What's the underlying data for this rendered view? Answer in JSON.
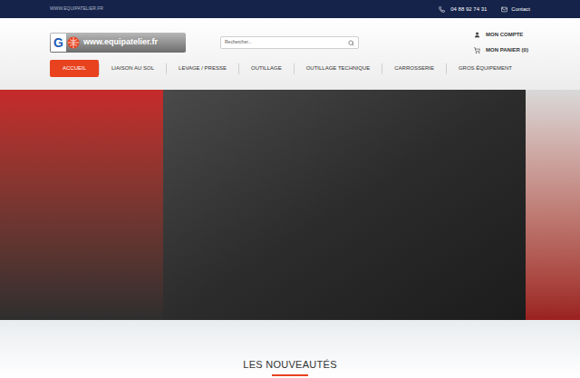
{
  "top_bar": {
    "site": "WWW.EQUIPATELIER.FR",
    "phone": "04 88 92 74 31",
    "contact": "Contact"
  },
  "logo": {
    "letter": "G",
    "text": "www.equipatelier.fr"
  },
  "search": {
    "placeholder": "Rechercher..."
  },
  "account": {
    "label": "MON COMPTE"
  },
  "cart": {
    "label": "MON PANIER (0)"
  },
  "nav": [
    {
      "label": "ACCUEIL",
      "selected": true
    },
    {
      "label": "LIAISON AU SOL",
      "selected": false
    },
    {
      "label": "LEVAGE / PRESSE",
      "selected": false
    },
    {
      "label": "OUTILLAGE",
      "selected": false
    },
    {
      "label": "OUTILLAGE TECHNIQUE",
      "selected": false
    },
    {
      "label": "CARROSSERIE",
      "selected": false
    },
    {
      "label": "GROS ÉQUIPEMENT",
      "selected": false
    }
  ],
  "section": {
    "title": "LES NOUVEAUTÉS"
  }
}
